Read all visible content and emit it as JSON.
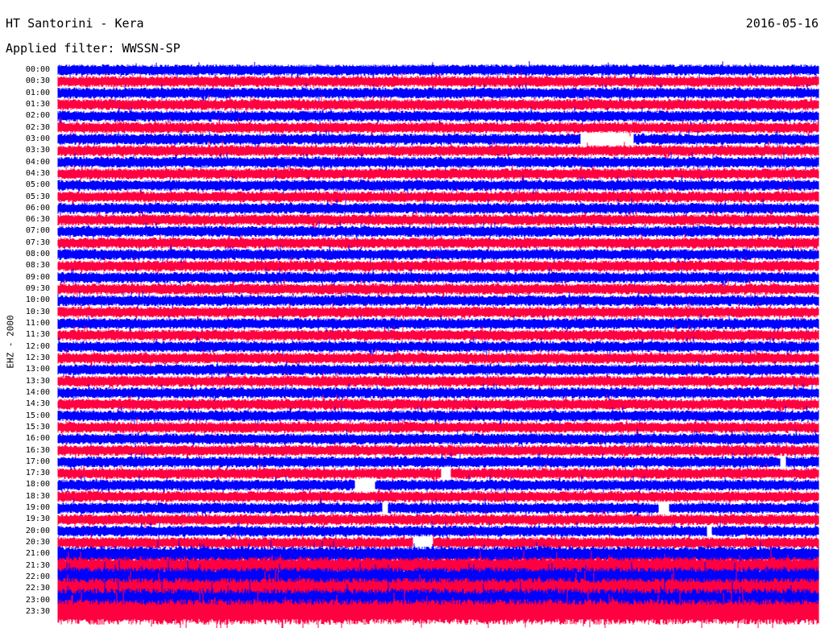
{
  "header": {
    "station": "HT Santorini - Kera",
    "date": "2016-05-16",
    "filter": "Applied filter: WWSSN-SP",
    "channel": "EHZ - 2000"
  },
  "chart_data": {
    "type": "line",
    "title": "HT Santorini - Kera",
    "subtitle": "Applied filter: WWSSN-SP",
    "ylabel": "EHZ - 2000",
    "xlabel": "",
    "x_range_minutes": [
      0,
      30
    ],
    "row_labels": [
      "00:00",
      "00:30",
      "01:00",
      "01:30",
      "02:00",
      "02:30",
      "03:00",
      "03:30",
      "04:00",
      "04:30",
      "05:00",
      "05:30",
      "06:00",
      "06:30",
      "07:00",
      "07:30",
      "08:00",
      "08:30",
      "09:00",
      "09:30",
      "10:00",
      "10:30",
      "11:00",
      "11:30",
      "12:00",
      "12:30",
      "13:00",
      "13:30",
      "14:00",
      "14:30",
      "15:00",
      "15:30",
      "16:00",
      "16:30",
      "17:00",
      "17:30",
      "18:00",
      "18:30",
      "19:00",
      "19:30",
      "20:00",
      "20:30",
      "21:00",
      "21:30",
      "22:00",
      "22:30",
      "23:00",
      "23:30"
    ],
    "series_colors": [
      "#0000ff",
      "#ff0040"
    ],
    "gaps_minutes": [
      {
        "row": "03:00",
        "start": 20.6,
        "end": 22.7
      },
      {
        "row": "17:00",
        "start": 28.5,
        "end": 28.7
      },
      {
        "row": "17:30",
        "start": 15.1,
        "end": 15.5
      },
      {
        "row": "18:00",
        "start": 11.7,
        "end": 12.5
      },
      {
        "row": "19:00",
        "start": 12.8,
        "end": 13.0
      },
      {
        "row": "19:00",
        "start": 23.7,
        "end": 24.0
      },
      {
        "row": "19:00",
        "start": 23.8,
        "end": 24.1
      },
      {
        "row": "20:00",
        "start": 25.6,
        "end": 25.8
      },
      {
        "row": "20:30",
        "start": 14.0,
        "end": 14.8
      }
    ]
  }
}
